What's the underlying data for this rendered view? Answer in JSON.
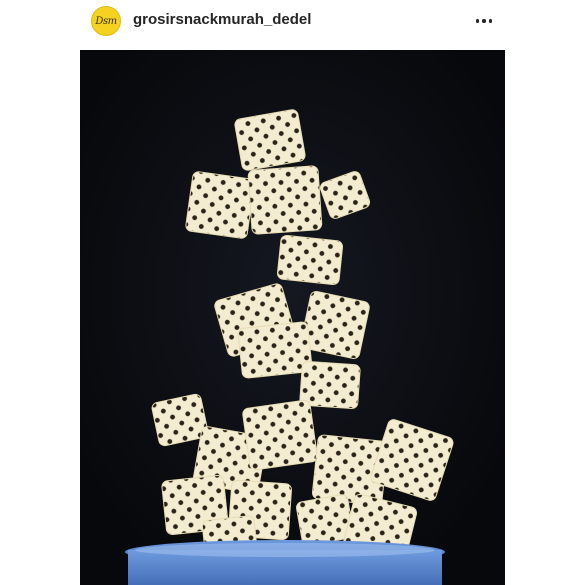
{
  "post": {
    "author": {
      "username": "grosirsnackmurah_dedel",
      "avatar_text": "Dsm",
      "avatar_color": "#f4d21f"
    },
    "more_icon": "more-horizontal-icon",
    "photo": {
      "subject": "stack of lattice crackers above blue bowl",
      "background_color": "#0b0d12",
      "bowl_color": "#4f7ec7",
      "cracker_color": "#f3ecd0"
    }
  }
}
